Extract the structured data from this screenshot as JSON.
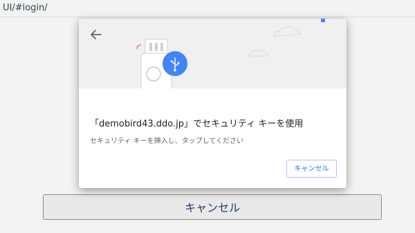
{
  "browser": {
    "url": "UI/#login/"
  },
  "page": {
    "cancel_label": "キャンセル"
  },
  "dialog": {
    "title": "「demobird43.ddo.jp」でセキュリティ キーを使用",
    "description": "セキュリティ キーを挿入し、タップしてください",
    "cancel_label": "キャンセル"
  },
  "colors": {
    "accent": "#1a73e8",
    "usb_circle": "#4285f4",
    "illustration_bg": "#f0f0f0",
    "page_bg": "#f3f3f3"
  },
  "icons": [
    "back-arrow-icon",
    "usb-icon",
    "security-key-icon",
    "cloud-icon"
  ]
}
